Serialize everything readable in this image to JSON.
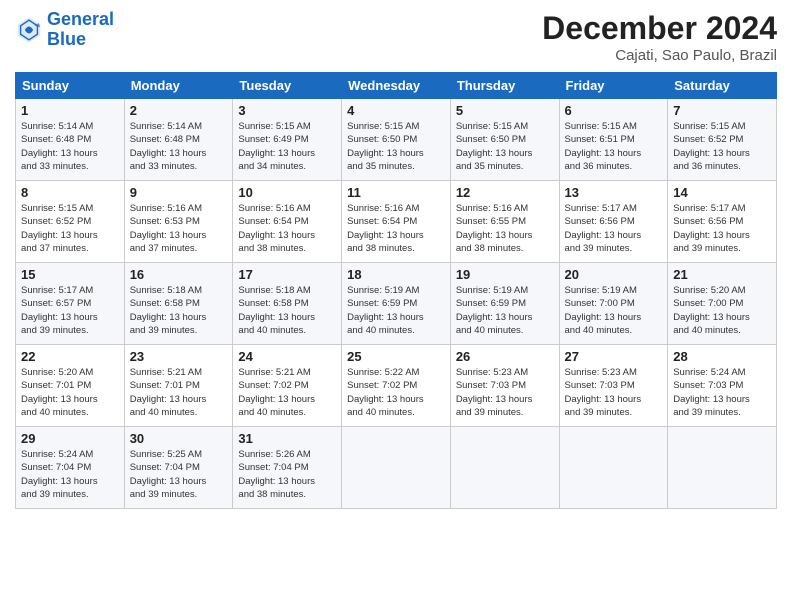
{
  "header": {
    "logo_line1": "General",
    "logo_line2": "Blue",
    "title": "December 2024",
    "subtitle": "Cajati, Sao Paulo, Brazil"
  },
  "calendar": {
    "days_of_week": [
      "Sunday",
      "Monday",
      "Tuesday",
      "Wednesday",
      "Thursday",
      "Friday",
      "Saturday"
    ],
    "weeks": [
      [
        {
          "day": "",
          "info": ""
        },
        {
          "day": "",
          "info": ""
        },
        {
          "day": "",
          "info": ""
        },
        {
          "day": "",
          "info": ""
        },
        {
          "day": "",
          "info": ""
        },
        {
          "day": "",
          "info": ""
        },
        {
          "day": "",
          "info": ""
        }
      ]
    ],
    "cells": [
      {
        "day": "1",
        "info": "Sunrise: 5:14 AM\nSunset: 6:48 PM\nDaylight: 13 hours\nand 33 minutes."
      },
      {
        "day": "2",
        "info": "Sunrise: 5:14 AM\nSunset: 6:48 PM\nDaylight: 13 hours\nand 33 minutes."
      },
      {
        "day": "3",
        "info": "Sunrise: 5:15 AM\nSunset: 6:49 PM\nDaylight: 13 hours\nand 34 minutes."
      },
      {
        "day": "4",
        "info": "Sunrise: 5:15 AM\nSunset: 6:50 PM\nDaylight: 13 hours\nand 35 minutes."
      },
      {
        "day": "5",
        "info": "Sunrise: 5:15 AM\nSunset: 6:50 PM\nDaylight: 13 hours\nand 35 minutes."
      },
      {
        "day": "6",
        "info": "Sunrise: 5:15 AM\nSunset: 6:51 PM\nDaylight: 13 hours\nand 36 minutes."
      },
      {
        "day": "7",
        "info": "Sunrise: 5:15 AM\nSunset: 6:52 PM\nDaylight: 13 hours\nand 36 minutes."
      },
      {
        "day": "8",
        "info": "Sunrise: 5:15 AM\nSunset: 6:52 PM\nDaylight: 13 hours\nand 37 minutes."
      },
      {
        "day": "9",
        "info": "Sunrise: 5:16 AM\nSunset: 6:53 PM\nDaylight: 13 hours\nand 37 minutes."
      },
      {
        "day": "10",
        "info": "Sunrise: 5:16 AM\nSunset: 6:54 PM\nDaylight: 13 hours\nand 38 minutes."
      },
      {
        "day": "11",
        "info": "Sunrise: 5:16 AM\nSunset: 6:54 PM\nDaylight: 13 hours\nand 38 minutes."
      },
      {
        "day": "12",
        "info": "Sunrise: 5:16 AM\nSunset: 6:55 PM\nDaylight: 13 hours\nand 38 minutes."
      },
      {
        "day": "13",
        "info": "Sunrise: 5:17 AM\nSunset: 6:56 PM\nDaylight: 13 hours\nand 39 minutes."
      },
      {
        "day": "14",
        "info": "Sunrise: 5:17 AM\nSunset: 6:56 PM\nDaylight: 13 hours\nand 39 minutes."
      },
      {
        "day": "15",
        "info": "Sunrise: 5:17 AM\nSunset: 6:57 PM\nDaylight: 13 hours\nand 39 minutes."
      },
      {
        "day": "16",
        "info": "Sunrise: 5:18 AM\nSunset: 6:58 PM\nDaylight: 13 hours\nand 39 minutes."
      },
      {
        "day": "17",
        "info": "Sunrise: 5:18 AM\nSunset: 6:58 PM\nDaylight: 13 hours\nand 40 minutes."
      },
      {
        "day": "18",
        "info": "Sunrise: 5:19 AM\nSunset: 6:59 PM\nDaylight: 13 hours\nand 40 minutes."
      },
      {
        "day": "19",
        "info": "Sunrise: 5:19 AM\nSunset: 6:59 PM\nDaylight: 13 hours\nand 40 minutes."
      },
      {
        "day": "20",
        "info": "Sunrise: 5:19 AM\nSunset: 7:00 PM\nDaylight: 13 hours\nand 40 minutes."
      },
      {
        "day": "21",
        "info": "Sunrise: 5:20 AM\nSunset: 7:00 PM\nDaylight: 13 hours\nand 40 minutes."
      },
      {
        "day": "22",
        "info": "Sunrise: 5:20 AM\nSunset: 7:01 PM\nDaylight: 13 hours\nand 40 minutes."
      },
      {
        "day": "23",
        "info": "Sunrise: 5:21 AM\nSunset: 7:01 PM\nDaylight: 13 hours\nand 40 minutes."
      },
      {
        "day": "24",
        "info": "Sunrise: 5:21 AM\nSunset: 7:02 PM\nDaylight: 13 hours\nand 40 minutes."
      },
      {
        "day": "25",
        "info": "Sunrise: 5:22 AM\nSunset: 7:02 PM\nDaylight: 13 hours\nand 40 minutes."
      },
      {
        "day": "26",
        "info": "Sunrise: 5:23 AM\nSunset: 7:03 PM\nDaylight: 13 hours\nand 39 minutes."
      },
      {
        "day": "27",
        "info": "Sunrise: 5:23 AM\nSunset: 7:03 PM\nDaylight: 13 hours\nand 39 minutes."
      },
      {
        "day": "28",
        "info": "Sunrise: 5:24 AM\nSunset: 7:03 PM\nDaylight: 13 hours\nand 39 minutes."
      },
      {
        "day": "29",
        "info": "Sunrise: 5:24 AM\nSunset: 7:04 PM\nDaylight: 13 hours\nand 39 minutes."
      },
      {
        "day": "30",
        "info": "Sunrise: 5:25 AM\nSunset: 7:04 PM\nDaylight: 13 hours\nand 39 minutes."
      },
      {
        "day": "31",
        "info": "Sunrise: 5:26 AM\nSunset: 7:04 PM\nDaylight: 13 hours\nand 38 minutes."
      }
    ]
  }
}
